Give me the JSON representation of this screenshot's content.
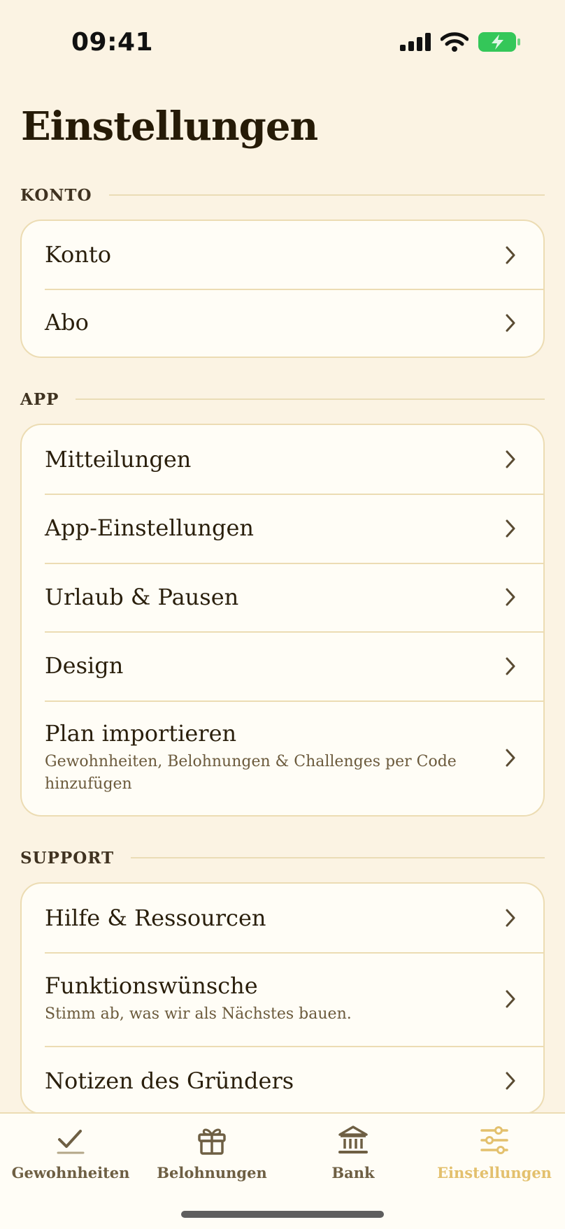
{
  "status_bar": {
    "time": "09:41",
    "icons": [
      "cellular-signal-icon",
      "wifi-icon",
      "battery-charging-icon"
    ],
    "battery_color": "#34c759"
  },
  "page": {
    "title": "Einstellungen"
  },
  "sections": [
    {
      "header": "KONTO",
      "items": [
        {
          "title": "Konto"
        },
        {
          "title": "Abo"
        }
      ]
    },
    {
      "header": "APP",
      "items": [
        {
          "title": "Mitteilungen"
        },
        {
          "title": "App-Einstellungen"
        },
        {
          "title": "Urlaub & Pausen"
        },
        {
          "title": "Design"
        },
        {
          "title": "Plan importieren",
          "subtitle": "Gewohnheiten, Belohnungen & Challenges per Code hinzufügen"
        }
      ]
    },
    {
      "header": "SUPPORT",
      "items": [
        {
          "title": "Hilfe & Ressourcen"
        },
        {
          "title": "Funktionswünsche",
          "subtitle": "Stimm ab, was wir als Nächstes bauen."
        },
        {
          "title": "Notizen des Gründers"
        }
      ]
    }
  ],
  "tab_bar": {
    "tabs": [
      {
        "label": "Gewohnheiten",
        "icon": "checkmark-icon",
        "active": false
      },
      {
        "label": "Belohnungen",
        "icon": "gift-icon",
        "active": false
      },
      {
        "label": "Bank",
        "icon": "bank-icon",
        "active": false
      },
      {
        "label": "Einstellungen",
        "icon": "sliders-icon",
        "active": true
      }
    ],
    "active_color": "#e3c06d",
    "inactive_color": "#6e5f43"
  },
  "colors": {
    "background": "#fbf3e3",
    "card": "#fffdf6",
    "border": "#ecdcb3"
  }
}
